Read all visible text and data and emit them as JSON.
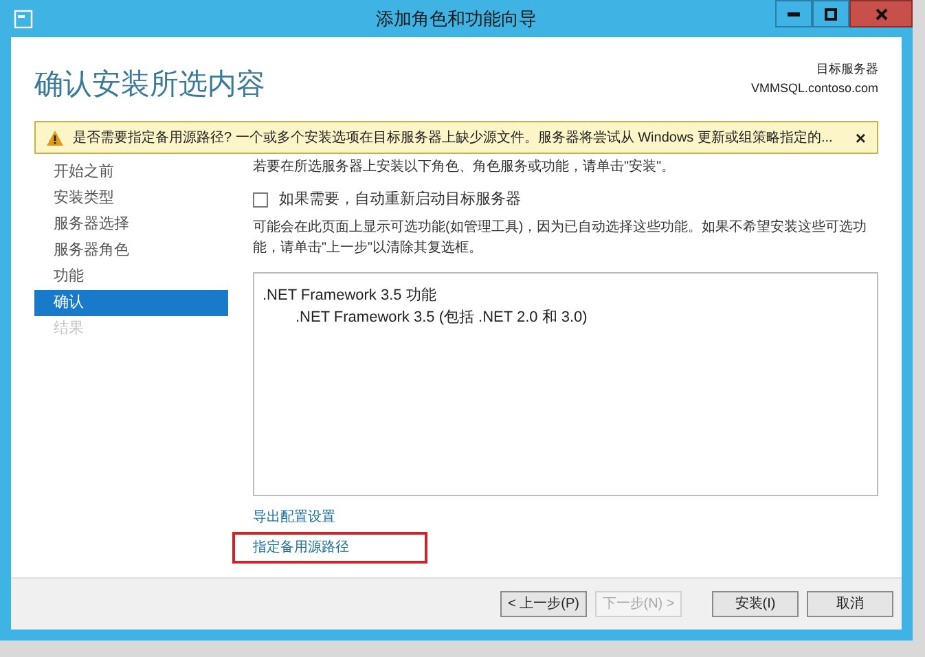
{
  "window": {
    "title": "添加角色和功能向导"
  },
  "header": {
    "title": "确认安装所选内容",
    "target_label": "目标服务器",
    "target_server": "VMMSQL.contoso.com"
  },
  "warning": {
    "text": "是否需要指定备用源路径? 一个或多个安装选项在目标服务器上缺少源文件。服务器将尝试从 Windows 更新或组策略指定的...",
    "close": "×"
  },
  "sidebar": {
    "items": [
      {
        "label": "开始之前",
        "selected": false,
        "disabled": false
      },
      {
        "label": "安装类型",
        "selected": false,
        "disabled": false
      },
      {
        "label": "服务器选择",
        "selected": false,
        "disabled": false
      },
      {
        "label": "服务器角色",
        "selected": false,
        "disabled": false
      },
      {
        "label": "功能",
        "selected": false,
        "disabled": false
      },
      {
        "label": "确认",
        "selected": true,
        "disabled": false
      },
      {
        "label": "结果",
        "selected": false,
        "disabled": true
      }
    ]
  },
  "content": {
    "intro": "若要在所选服务器上安装以下角色、角色服务或功能，请单击\"安装\"。",
    "restart": {
      "label": "如果需要，自动重新启动目标服务器",
      "checked": false
    },
    "note": "可能会在此页面上显示可选功能(如管理工具)，因为已自动选择这些功能。如果不希望安装这些可选功能，请单击\"上一步\"以清除其复选框。",
    "features": [
      {
        "label": ".NET Framework 3.5 功能",
        "children": [
          {
            "label": ".NET Framework 3.5 (包括 .NET 2.0 和 3.0)"
          }
        ]
      }
    ],
    "links": [
      {
        "label": "导出配置设置",
        "highlighted": false
      },
      {
        "label": "指定备用源路径",
        "highlighted": true
      }
    ]
  },
  "nav_buttons": [
    {
      "label": "< 上一步(P)",
      "disabled": false
    },
    {
      "label": "下一步(N) >",
      "disabled": true
    }
  ],
  "action_buttons": [
    {
      "label": "安装(I)",
      "disabled": false
    },
    {
      "label": "取消",
      "disabled": false
    }
  ]
}
